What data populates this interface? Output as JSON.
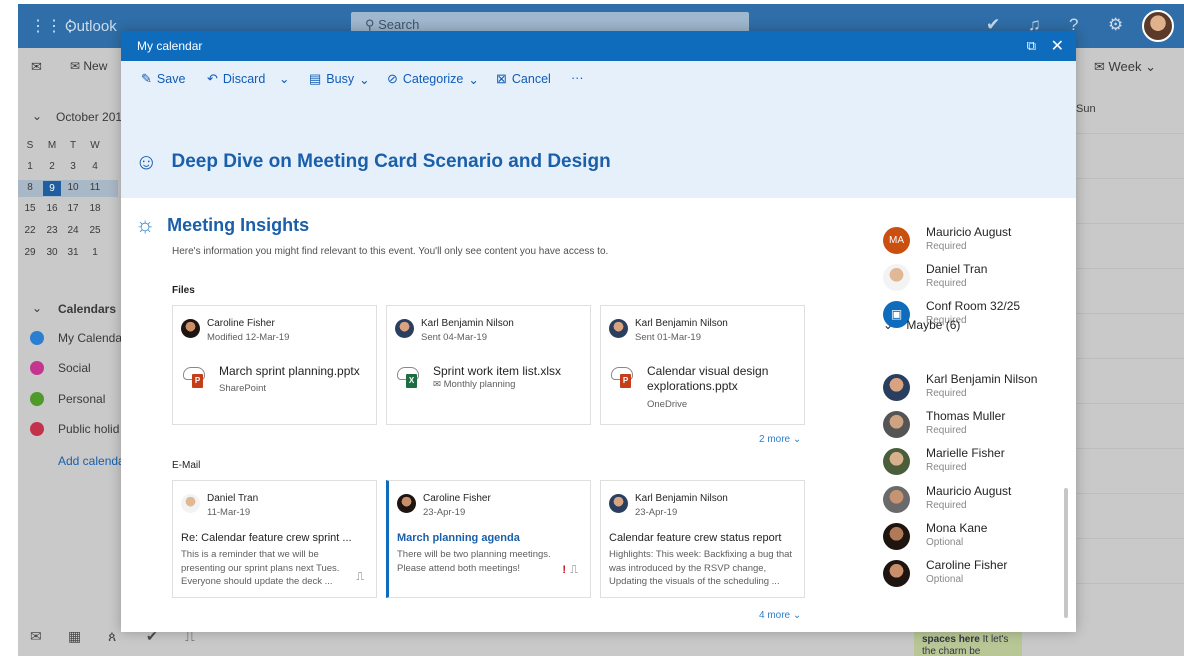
{
  "app": {
    "name": "Outlook",
    "search_placeholder": "Search"
  },
  "left_pane": {
    "new_button": "New",
    "month_label": "October 201",
    "weekdays": [
      "S",
      "M",
      "T",
      "W"
    ],
    "weeks": [
      [
        "1",
        "2",
        "3",
        "4"
      ],
      [
        "8",
        "9",
        "10",
        "11"
      ],
      [
        "15",
        "16",
        "17",
        "18"
      ],
      [
        "22",
        "23",
        "24",
        "25"
      ],
      [
        "29",
        "30",
        "31",
        "1"
      ]
    ],
    "calendars_header": "Calendars",
    "calendars": [
      {
        "label": "My Calenda",
        "color": "#2b7fd0"
      },
      {
        "label": "Social",
        "color": "#c3358f"
      },
      {
        "label": "Personal",
        "color": "#4e9a2a"
      },
      {
        "label": "Public holid",
        "color": "#c4314b"
      }
    ],
    "add_calendar": "Add calenda"
  },
  "right_bg": {
    "week_button": "Week",
    "sun_label": "Sun"
  },
  "bottom_teaser": {
    "bold": "spaces here",
    "text": "It let's",
    "text2": "the charm be"
  },
  "dialog": {
    "title": "My calendar",
    "toolbar": {
      "save": "Save",
      "discard": "Discard",
      "busy": "Busy",
      "categorize": "Categorize",
      "cancel": "Cancel",
      "more": "···"
    },
    "event_title": "Deep Dive on Meeting Card Scenario and Design",
    "insights": {
      "heading": "Meeting Insights",
      "subtitle": "Here's information you might find relevant to this event. You'll only see content you have access to.",
      "files_label": "Files",
      "files": [
        {
          "author": "Caroline Fisher",
          "date": "Modified 12-Mar-19",
          "filename": "March sprint planning.pptx",
          "location": "SharePoint",
          "type": "P",
          "type_color": "#c43e1c"
        },
        {
          "author": "Karl Benjamin Nilson",
          "date": "Sent 04-Mar-19",
          "filename": "Sprint work item list.xlsx",
          "location": "Monthly planning",
          "type": "X",
          "type_color": "#1d6f42"
        },
        {
          "author": "Karl Benjamin Nilson",
          "date": "Sent 01-Mar-19",
          "filename": "Calendar visual design explorations.pptx",
          "location": "OneDrive",
          "type": "P",
          "type_color": "#c43e1c"
        }
      ],
      "files_more": "2 more",
      "email_label": "E-Mail",
      "emails": [
        {
          "sender": "Daniel Tran",
          "date": "11-Mar-19",
          "subject": "Re: Calendar feature crew sprint ...",
          "preview": "This is a reminder that we will be presenting our sprint plans next Tues. Everyone should update the deck ..."
        },
        {
          "sender": "Caroline Fisher",
          "date": "23-Apr-19",
          "subject": "March planning agenda",
          "preview": "There will be two planning meetings. Please attend both meetings!"
        },
        {
          "sender": "Karl Benjamin Nilson",
          "date": "23-Apr-19",
          "subject": "Calendar feature crew status report",
          "preview": "Highlights: This week: Backfixing a bug that was introduced by the RSVP change, Updating the visuals of the scheduling ..."
        }
      ],
      "emails_more": "4 more"
    },
    "attendees": {
      "required": [
        {
          "name": "Mauricio August",
          "role": "Required",
          "initials": "MA"
        },
        {
          "name": "Daniel Tran",
          "role": "Required"
        },
        {
          "name": "Conf Room 32/25",
          "role": "Required"
        }
      ],
      "maybe_header": "Maybe (6)",
      "maybe": [
        {
          "name": "Karl Benjamin Nilson",
          "role": "Required"
        },
        {
          "name": "Thomas Muller",
          "role": "Required"
        },
        {
          "name": "Marielle Fisher",
          "role": "Required"
        },
        {
          "name": "Mauricio August",
          "role": "Required"
        },
        {
          "name": "Mona Kane",
          "role": "Optional"
        },
        {
          "name": "Caroline Fisher",
          "role": "Optional"
        }
      ]
    }
  },
  "colors": {
    "accent": "#0f6cbd",
    "header_bg": "#e6f0fb",
    "title_blue": "#1a5faa"
  }
}
